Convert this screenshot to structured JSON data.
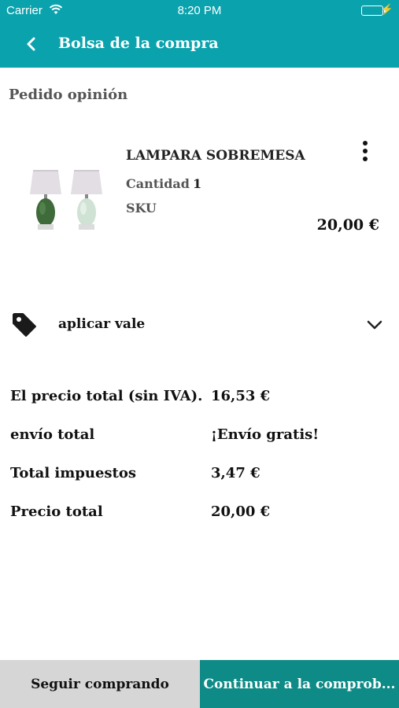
{
  "status_bar": {
    "carrier": "Carrier",
    "time": "8:20 PM",
    "battery_level": 1.0
  },
  "nav": {
    "title": "Bolsa de la compra",
    "back_icon": "chevron-left-icon"
  },
  "section_title": "Pedido opinión",
  "product": {
    "name": "LAMPARA SOBREMESA",
    "quantity_label": "Cantidad",
    "quantity_value": "1",
    "sku_label": "SKU",
    "price": "20,00 €",
    "image": "two-table-lamps",
    "menu_icon": "more-vertical-icon"
  },
  "voucher": {
    "label": "aplicar vale",
    "icon": "tag-icon",
    "expand_icon": "chevron-down-icon"
  },
  "summary": [
    {
      "label": "El precio total (sin IVA).",
      "value": "16,53 €"
    },
    {
      "label": "envío total",
      "value": "¡Envío gratis!"
    },
    {
      "label": "Total impuestos",
      "value": "3,47 €"
    },
    {
      "label": "Precio total",
      "value": "20,00 €"
    }
  ],
  "actions": {
    "continue_shopping": "Seguir comprando",
    "checkout": "Continuar a la comprob..."
  },
  "colors": {
    "header": "#0aa3ad",
    "checkout_button": "#0e8b86",
    "secondary_button": "#d6d6d6"
  }
}
